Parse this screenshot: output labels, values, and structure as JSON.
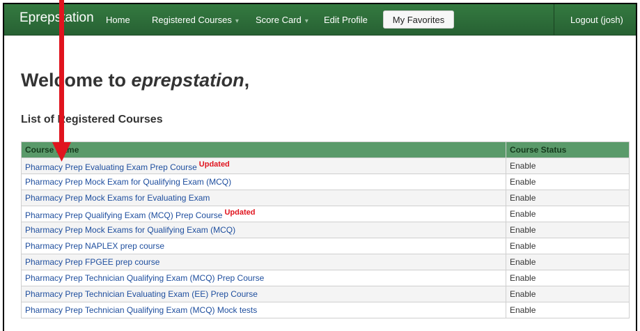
{
  "navbar": {
    "brand": "Eprepstation",
    "items": [
      {
        "label": "Home"
      },
      {
        "label": "Registered Courses"
      },
      {
        "label": "Score Card"
      },
      {
        "label": "Edit Profile"
      }
    ],
    "favorites_button": "My Favorites",
    "logout_label": "Logout (josh)",
    "caret": "▾"
  },
  "welcome": {
    "prefix": "Welcome to ",
    "site": "eprepstation",
    "suffix": ","
  },
  "courses": {
    "heading": "List of Registered Courses",
    "columns": [
      "Course Name",
      "Course Status"
    ],
    "updated_badge": "Updated",
    "rows": [
      {
        "name": "Pharmacy Prep Evaluating Exam Prep Course",
        "status": "Enable",
        "updated": true
      },
      {
        "name": "Pharmacy Prep Mock Exam for Qualifying Exam (MCQ)",
        "status": "Enable",
        "updated": false
      },
      {
        "name": "Pharmacy Prep Mock Exams for Evaluating Exam",
        "status": "Enable",
        "updated": false
      },
      {
        "name": "Pharmacy Prep Qualifying Exam (MCQ) Prep Course",
        "status": "Enable",
        "updated": true
      },
      {
        "name": "Pharmacy Prep Mock Exams for Qualifying Exam (MCQ)",
        "status": "Enable",
        "updated": false
      },
      {
        "name": "Pharmacy Prep NAPLEX prep course",
        "status": "Enable",
        "updated": false
      },
      {
        "name": "Pharmacy Prep FPGEE prep course",
        "status": "Enable",
        "updated": false
      },
      {
        "name": "Pharmacy Prep Technician Qualifying Exam (MCQ) Prep Course",
        "status": "Enable",
        "updated": false
      },
      {
        "name": "Pharmacy Prep Technician Evaluating Exam (EE) Prep Course",
        "status": "Enable",
        "updated": false
      },
      {
        "name": "Pharmacy Prep Technician Qualifying Exam (MCQ) Mock tests",
        "status": "Enable",
        "updated": false
      }
    ]
  },
  "colors": {
    "navbar": "#2c6b38",
    "table_header": "#5a9a6a",
    "link": "#1e4e9e",
    "updated_badge": "#e0141e",
    "annotation_arrow": "#e0141e"
  },
  "annotation": {
    "icon": "red-arrow-down-icon"
  }
}
